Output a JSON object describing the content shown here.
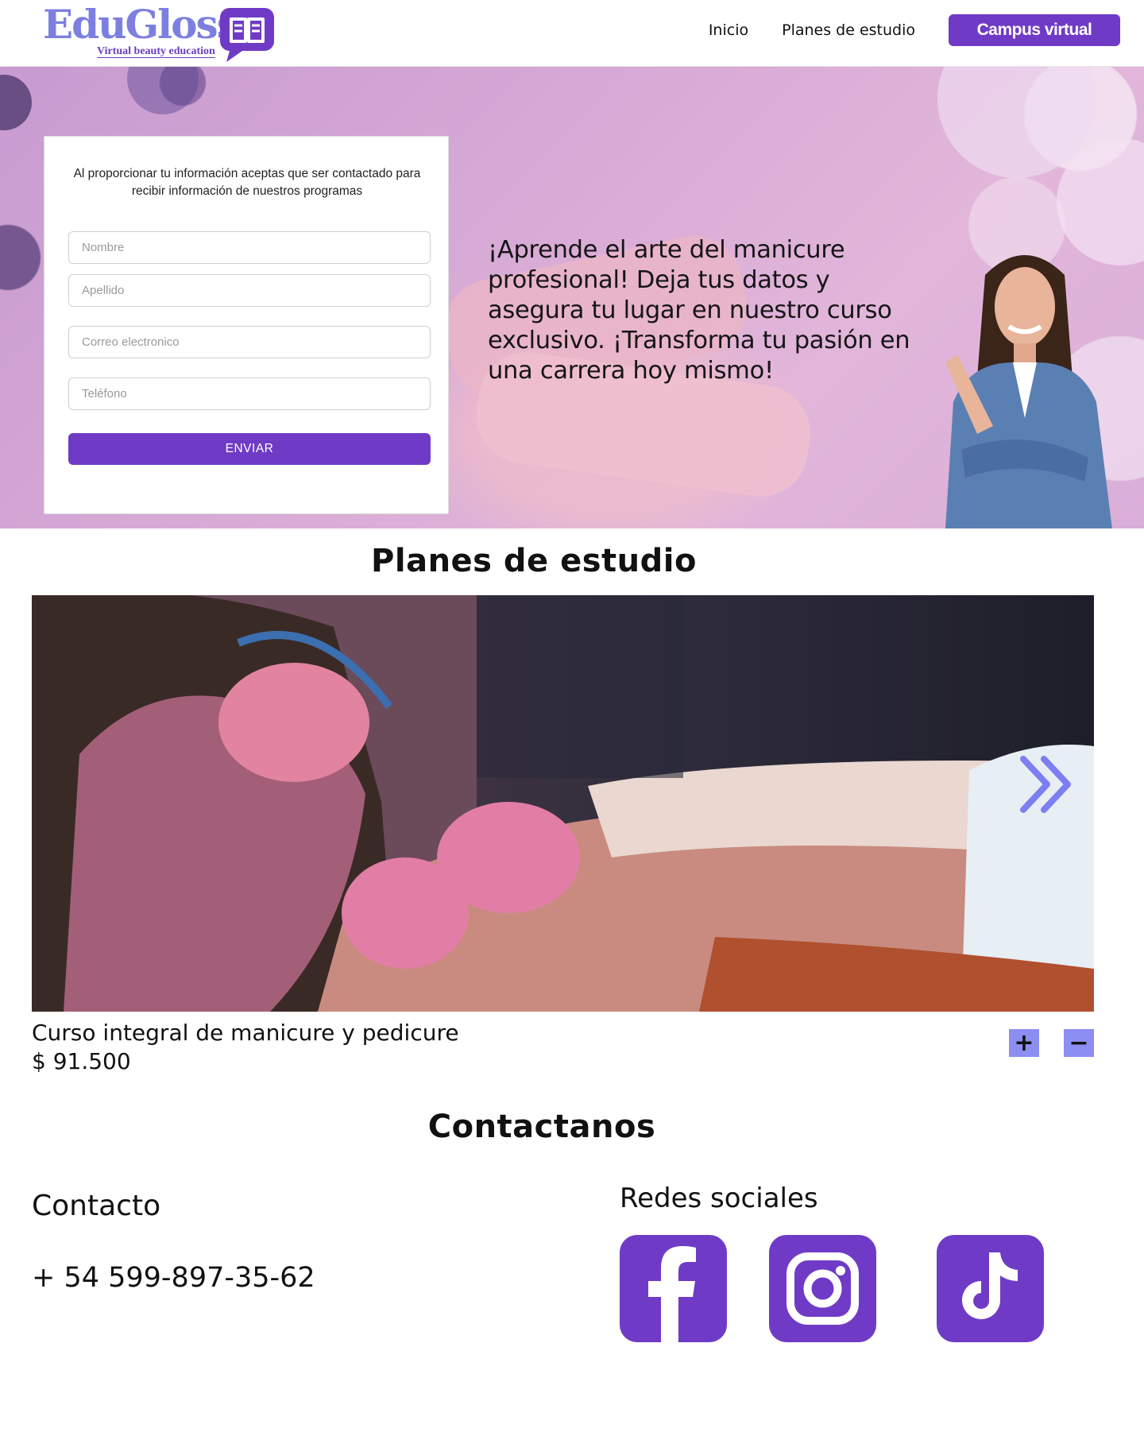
{
  "header": {
    "logo_word": "EduGloss",
    "logo_tagline": "Virtual beauty education",
    "nav": {
      "home_label": "Inicio",
      "plans_label": "Planes de estudio",
      "campus_label": "Campus virtual"
    }
  },
  "hero": {
    "form": {
      "note": "Al proporcionar tu información aceptas que ser contactado para recibir información de nuestros programas",
      "first_name_placeholder": "Nombre",
      "last_name_placeholder": "Apellido",
      "email_placeholder": "Correo electronico",
      "phone_placeholder": "Teléfono",
      "submit_label": "ENVIAR"
    },
    "headline": "¡Aprende el arte del manicure profesional! Deja tus datos y asegura tu lugar en nuestro curso exclusivo. ¡Transforma tu pasión en una carrera hoy mismo!"
  },
  "plans": {
    "title": "Planes de estudio",
    "course": {
      "name": "Curso integral de manicure y pedicure",
      "price": "$ 91.500",
      "increase_label": "+",
      "decrease_label": "−"
    }
  },
  "contact": {
    "title": "Contactanos",
    "contact_heading": "Contacto",
    "phone": "+ 54 599-897-35-62",
    "social_heading": "Redes sociales",
    "social_icons": [
      "facebook-icon",
      "instagram-icon",
      "tiktok-icon"
    ]
  },
  "colors": {
    "accent": "#6f3bc6",
    "logo": "#7d7fe0",
    "quantity_button": "#8c8ef2",
    "hero_tint": "#d7a9d6"
  }
}
